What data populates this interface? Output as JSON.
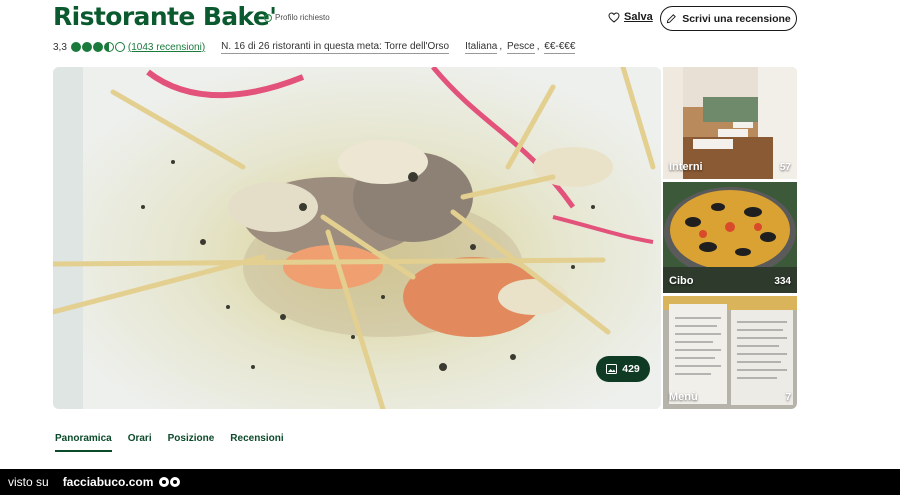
{
  "header": {
    "title": "Ristorante Bake'",
    "claim_status": "Profilo richiesto",
    "save_label": "Salva",
    "review_button": "Scrivi una recensione"
  },
  "meta": {
    "rating": "3,3",
    "rating_bubbles": 3.5,
    "reviews_link": "(1043 recensioni)",
    "rank": "N. 16 di 26 ristoranti in questa meta: Torre dell'Orso",
    "cuisines": [
      "Italiana",
      "Pesce",
      "€€-€€€"
    ]
  },
  "gallery": {
    "photo_count": "429",
    "thumbnails": [
      {
        "label": "Interni",
        "count": "57"
      },
      {
        "label": "Cibo",
        "count": "334"
      },
      {
        "label": "Menù",
        "count": "7"
      }
    ]
  },
  "tabs": [
    "Panoramica",
    "Orari",
    "Posizione",
    "Recensioni"
  ],
  "footer": {
    "seen_on": "visto su",
    "site": "facciabuco.com"
  },
  "colors": {
    "brand_green": "#0b5a2f",
    "bubble_green": "#1a7a3c",
    "badge_dark": "#0f3b25"
  }
}
